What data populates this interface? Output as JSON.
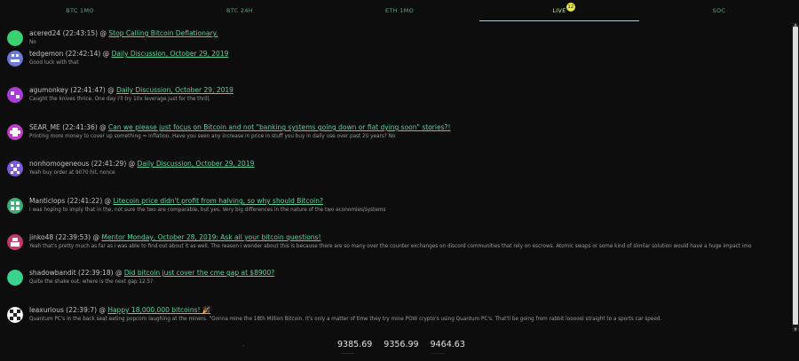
{
  "tabs": [
    {
      "label": "BTC 1MO",
      "active": false
    },
    {
      "label": "BTC 24H",
      "active": false
    },
    {
      "label": "ETH 1MO",
      "active": false
    },
    {
      "label": "LIVE",
      "active": true,
      "badge": "12"
    },
    {
      "label": "SOC",
      "active": false
    }
  ],
  "posts": [
    {
      "user": "acered24",
      "time": "(22:43:15)",
      "at": "@",
      "link": "Stop Calling Bitcoin Deflationary.",
      "body": "No",
      "avatar_color": "#3bd16f"
    },
    {
      "user": "tedgemon",
      "time": "(22:42:14)",
      "at": "@",
      "link": "Daily Discussion, October 29, 2019",
      "body": "Good luck with that",
      "avatar_color": "#6a7bd8"
    },
    {
      "user": "agumonkey",
      "time": "(22:41:47)",
      "at": "@",
      "link": "Daily Discussion, October 29, 2019",
      "body": "Caught the knives thrice. One day i'll try 10x leverage just for the thrill.",
      "avatar_color": "#a93cd6"
    },
    {
      "user": "SEAR_ME",
      "time": "(22:41:36)",
      "at": "@",
      "link": "Can we please just focus on Bitcoin and not \"banking systems going down or fiat dying soon\" stories?!",
      "body": "Printing more money to cover up something = inflation. Have you seen any increase in price in stuff you buy in daily use over past 20 years? No",
      "avatar_color": "#c03cc8"
    },
    {
      "user": "nonhomogeneous",
      "time": "(22:41:29)",
      "at": "@",
      "link": "Daily Discussion, October 29, 2019",
      "body": "Yeah buy order at 9070 hit, nonce",
      "avatar_color": "#7a5cd6"
    },
    {
      "user": "Manticlops",
      "time": "(22:41:22)",
      "at": "@",
      "link": "Litecoin price didn't profit from halving, so why should Bitcoin?",
      "body": "I was hoping to imply that in the, not sure the two are comparable, but yes. Very big differences in the nature of the two economies/systems",
      "avatar_color": "#3fae73"
    },
    {
      "user": "jinko48",
      "time": "(22:39:53)",
      "at": "@",
      "link": "Mentor Monday, October 28, 2019: Ask all your bitcoin questions!",
      "body": "Yeah that's pretty much as far as i was able to find out about it as well. The reason i wonder about this is because there are so many over the counter exchanges on discord communities that rely on escrows. Atomic swaps or some kind of similar solution would have a huge impact imo",
      "avatar_color": "#c23b6a"
    },
    {
      "user": "shadowbandit",
      "time": "(22:39:18)",
      "at": "@",
      "link": "Did bitcoin just cover the cme gap at $8900?",
      "body": "Quite the shake out, where is the next gap 12.5?",
      "avatar_color": "#38d38c"
    },
    {
      "user": "leaxurious",
      "time": "(22:39:7)",
      "at": "@",
      "link": "Happy 18,000,000 bitcoins! 🎉",
      "body": "Quantum PC's in the back seat eating popcorn laughing at the miners. \"Gonna mine the 18th Million Bitcoin. It's only a matter of time they try mine POW crypto's using Quantum PC's. That'll be going from rabbit loooool straight to a sports car speed.",
      "avatar_color": "#dddddd"
    }
  ],
  "ticker": {
    "mark": ",",
    "prices": [
      "9385.69",
      "9356.99",
      "9464.63"
    ],
    "sub_left": "———",
    "sub_right": "———"
  },
  "colors": {
    "accent": "#a8e66b",
    "link": "#57d39a",
    "background": "#0d0d0d"
  }
}
